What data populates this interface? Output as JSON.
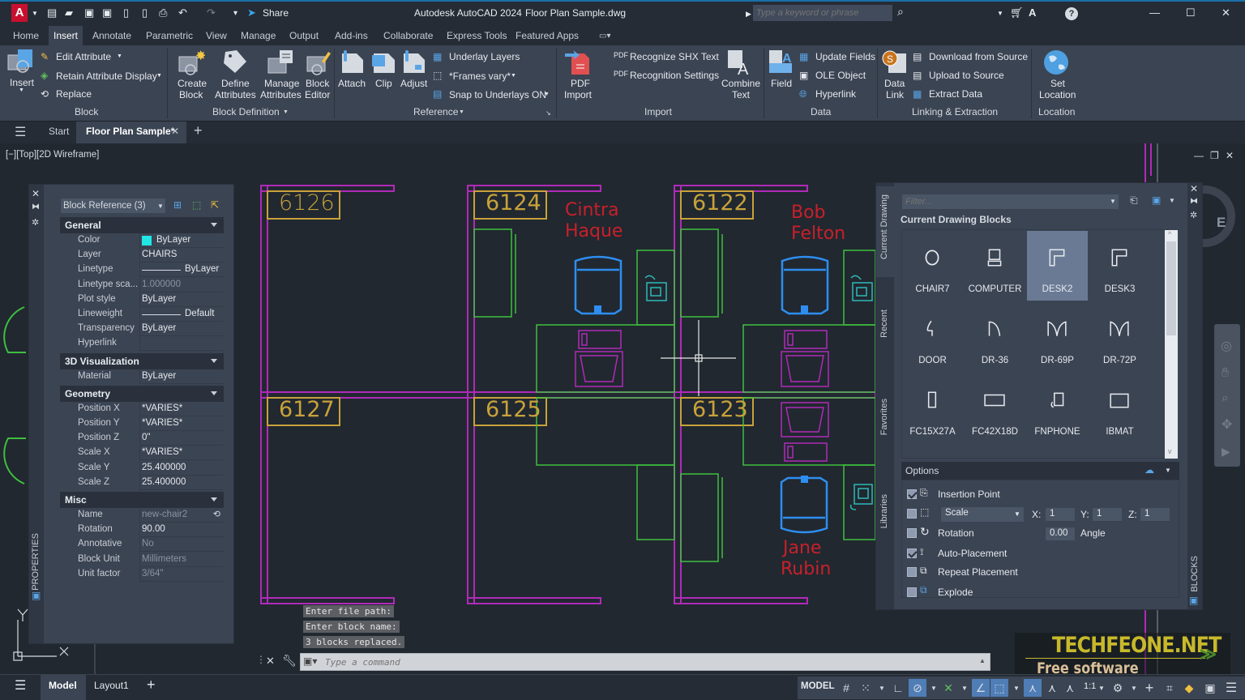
{
  "title_bar": {
    "app_title": "Autodesk AutoCAD 2024",
    "file_title": "Floor Plan Sample.dwg",
    "share_label": "Share",
    "search_placeholder": "Type a keyword or phrase",
    "icons": [
      "app-menu-icon",
      "new-icon",
      "open-icon",
      "save-icon",
      "save-as-icon",
      "open-web-icon",
      "save-web-icon",
      "plot-icon",
      "undo-icon",
      "redo-icon",
      "customize-icon",
      "share-icon",
      "search-icon",
      "cart-icon",
      "autodesk-account-icon",
      "help-icon",
      "minimize-icon",
      "maximize-icon",
      "close-icon"
    ]
  },
  "menu_tabs": [
    "Home",
    "Insert",
    "Annotate",
    "Parametric",
    "View",
    "Manage",
    "Output",
    "Add-ins",
    "Collaborate",
    "Express Tools",
    "Featured Apps"
  ],
  "active_menu_tab": "Insert",
  "ribbon": {
    "block": {
      "group_label": "Block",
      "insert": "Insert",
      "edit_attribute": "Edit Attribute",
      "retain_attribute_display": "Retain Attribute Display",
      "replace": "Replace"
    },
    "block_definition": {
      "group_label": "Block Definition",
      "create_block": [
        "Create",
        "Block"
      ],
      "define_attributes": [
        "Define",
        "Attributes"
      ],
      "manage_attributes": [
        "Manage",
        "Attributes"
      ],
      "block_editor": [
        "Block",
        "Editor"
      ]
    },
    "reference": {
      "group_label": "Reference",
      "attach": "Attach",
      "clip": "Clip",
      "adjust": "Adjust",
      "underlay_layers": "Underlay Layers",
      "frames_vary": "*Frames vary*",
      "snap_to_underlays": "Snap to Underlays ON"
    },
    "import": {
      "group_label": "Import",
      "pdf_import": [
        "PDF",
        "Import"
      ],
      "recognize_shx": "Recognize SHX Text",
      "recognition_settings": "Recognition Settings",
      "combine_text": [
        "Combine",
        "Text"
      ]
    },
    "data": {
      "group_label": "Data",
      "field": "Field",
      "update_fields": "Update Fields",
      "ole_object": "OLE Object",
      "hyperlink": "Hyperlink"
    },
    "linking": {
      "group_label": "Linking & Extraction",
      "data_link": [
        "Data",
        "Link"
      ],
      "download_from_source": "Download from Source",
      "upload_to_source": "Upload to Source",
      "extract_data": "Extract  Data"
    },
    "location": {
      "group_label": "Location",
      "set_location": [
        "Set",
        "Location"
      ]
    }
  },
  "file_tabs": {
    "start": "Start",
    "active": "Floor Plan Sample*"
  },
  "viewport_label": "[−][Top][2D Wireframe]",
  "properties_panel": {
    "title": "PROPERTIES",
    "selection": "Block Reference (3)",
    "sections": [
      {
        "name": "General",
        "rows": [
          {
            "key": "Color",
            "value": "ByLayer",
            "swatch": "#22e6e6"
          },
          {
            "key": "Layer",
            "value": "CHAIRS"
          },
          {
            "key": "Linetype",
            "value": "ByLayer",
            "line": true
          },
          {
            "key": "Linetype sca...",
            "value": "1.000000",
            "dim": true
          },
          {
            "key": "Plot style",
            "value": "ByLayer"
          },
          {
            "key": "Lineweight",
            "value": "Default",
            "line": true
          },
          {
            "key": "Transparency",
            "value": "ByLayer"
          },
          {
            "key": "Hyperlink",
            "value": ""
          }
        ]
      },
      {
        "name": "3D Visualization",
        "rows": [
          {
            "key": "Material",
            "value": "ByLayer"
          }
        ]
      },
      {
        "name": "Geometry",
        "rows": [
          {
            "key": "Position X",
            "value": "*VARIES*"
          },
          {
            "key": "Position Y",
            "value": "*VARIES*"
          },
          {
            "key": "Position Z",
            "value": "0\""
          },
          {
            "key": "Scale X",
            "value": "*VARIES*"
          },
          {
            "key": "Scale Y",
            "value": "25.400000"
          },
          {
            "key": "Scale Z",
            "value": "25.400000"
          }
        ]
      },
      {
        "name": "Misc",
        "rows": [
          {
            "key": "Name",
            "value": "new-chair2",
            "dim": true
          },
          {
            "key": "Rotation",
            "value": "90.00"
          },
          {
            "key": "Annotative",
            "value": "No",
            "dim": true
          },
          {
            "key": "Block Unit",
            "value": "Millimeters",
            "dim": true
          },
          {
            "key": "Unit factor",
            "value": "3/64\"",
            "dim": true
          }
        ]
      }
    ]
  },
  "drawing": {
    "rooms": [
      "6126",
      "6124",
      "6122",
      "6127",
      "6125",
      "6123"
    ],
    "occupants": [
      [
        "Cintra",
        "Haque"
      ],
      [
        "Bob",
        "Felton"
      ],
      [
        "Jane",
        "Rubin"
      ]
    ],
    "colors": {
      "wall": "#b02ab8",
      "room_label": "#c8a23a",
      "furniture": "#3fbf3f",
      "chair": "#2e8ef0",
      "name": "#c8202a",
      "phone": "#30b8b8",
      "crosshair": "#e8e8e8"
    }
  },
  "blocks_panel": {
    "title": "BLOCKS",
    "filter_placeholder": "Filter...",
    "section_label": "Current Drawing Blocks",
    "side_tabs": [
      "Current Drawing",
      "Recent",
      "Favorites",
      "Libraries"
    ],
    "items": [
      {
        "name": "CHAIR7"
      },
      {
        "name": "COMPUTER"
      },
      {
        "name": "DESK2",
        "selected": true
      },
      {
        "name": "DESK3"
      },
      {
        "name": "DOOR"
      },
      {
        "name": "DR-36"
      },
      {
        "name": "DR-69P"
      },
      {
        "name": "DR-72P"
      },
      {
        "name": "FC15X27A"
      },
      {
        "name": "FC42X18D"
      },
      {
        "name": "FNPHONE"
      },
      {
        "name": "IBMAT"
      }
    ],
    "options": {
      "label": "Options",
      "insertion_point": {
        "label": "Insertion Point",
        "checked": true
      },
      "scale": {
        "label": "Scale",
        "checked": false,
        "x": "1",
        "y": "1",
        "z": "1"
      },
      "rotation": {
        "label": "Rotation",
        "checked": false,
        "angle": "0.00",
        "angle_label": "Angle"
      },
      "auto_placement": {
        "label": "Auto-Placement",
        "checked": true
      },
      "repeat_placement": {
        "label": "Repeat Placement",
        "checked": false
      },
      "explode": {
        "label": "Explode",
        "checked": false
      }
    }
  },
  "viewcube_letter": "E",
  "command_line": {
    "history": [
      "Enter file path:",
      "Enter block name:",
      "3 blocks replaced."
    ],
    "placeholder": "Type a command"
  },
  "layout_tabs": [
    "Model",
    "Layout1"
  ],
  "status_bar": {
    "model_label": "MODEL",
    "scale": "1:1"
  },
  "watermark": {
    "title": "TECHFEONE.NET",
    "subtitle": "Free software download site"
  }
}
